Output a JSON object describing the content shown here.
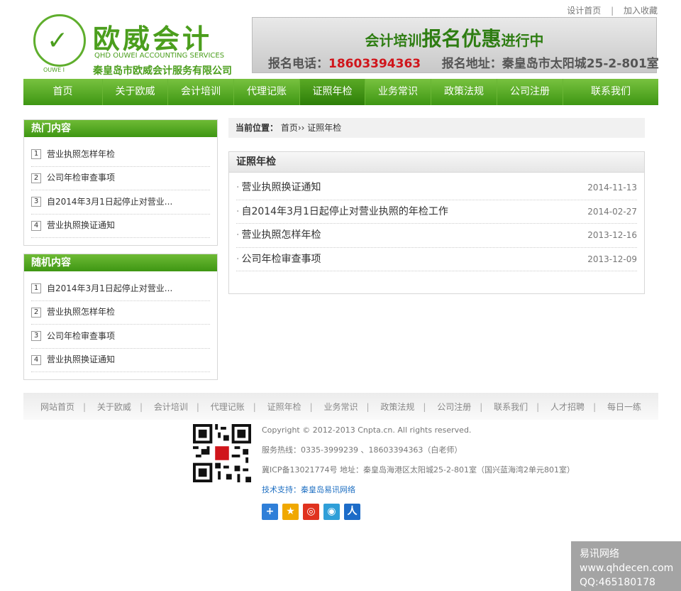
{
  "top_links": {
    "design_home": "设计首页",
    "add_favorite": "加入收藏",
    "separator": "|"
  },
  "logo": {
    "cn_title": "欧威会计",
    "en_sub": "QHD OUWEI ACCOUNTING SERVICES",
    "company": "秦皇岛市欧威会计服务有限公司",
    "mark_text": "OUWE I"
  },
  "banner": {
    "line1_small_a": "会计培训",
    "line1_big": "报名优惠",
    "line1_small_b": "进行中",
    "phone_label": "报名电话：",
    "phone": "18603394363",
    "address_label": "报名地址：",
    "address": "秦皇岛市太阳城25-2-801室"
  },
  "nav": {
    "items": [
      {
        "label": "首页"
      },
      {
        "label": "关于欧威"
      },
      {
        "label": "会计培训"
      },
      {
        "label": "代理记账"
      },
      {
        "label": "证照年检"
      },
      {
        "label": "业务常识"
      },
      {
        "label": "政策法规"
      },
      {
        "label": "公司注册"
      },
      {
        "label": "联系我们"
      }
    ],
    "active_index": 4
  },
  "hot": {
    "title": "热门内容",
    "items": [
      {
        "num": "1",
        "text": "营业执照怎样年检"
      },
      {
        "num": "2",
        "text": "公司年检审查事项"
      },
      {
        "num": "3",
        "text": "自2014年3月1日起停止对营业..."
      },
      {
        "num": "4",
        "text": "营业执照换证通知"
      }
    ]
  },
  "random": {
    "title": "随机内容",
    "items": [
      {
        "num": "1",
        "text": "自2014年3月1日起停止对营业..."
      },
      {
        "num": "2",
        "text": "营业执照怎样年检"
      },
      {
        "num": "3",
        "text": "公司年检审查事项"
      },
      {
        "num": "4",
        "text": "营业执照换证通知"
      }
    ]
  },
  "breadcrumb": {
    "label": "当前位置：",
    "home": "首页",
    "sep": "››",
    "current": "证照年检"
  },
  "panel": {
    "title": "证照年检",
    "articles": [
      {
        "title": "营业执照换证通知",
        "date": "2014-11-13"
      },
      {
        "title": "自2014年3月1日起停止对营业执照的年检工作",
        "date": "2014-02-27"
      },
      {
        "title": "营业执照怎样年检",
        "date": "2013-12-16"
      },
      {
        "title": "公司年检审查事项",
        "date": "2013-12-09"
      }
    ]
  },
  "footer_nav": [
    "网站首页",
    "关于欧威",
    "会计培训",
    "代理记账",
    "证照年检",
    "业务常识",
    "政策法规",
    "公司注册",
    "联系我们",
    "人才招聘",
    "每日一练"
  ],
  "footer": {
    "copyright": "Copyright © 2012-2013 Cnpta.cn. All rights reserved.",
    "hotline": "服务热线：0335-3999239 、18603394363（白老师）",
    "icp": "冀ICP备13021774号  地址：秦皇岛海港区太阳城25-2-801室（国兴蓝海湾2单元801室）",
    "support": "技术支持：秦皇岛易讯网络"
  },
  "share_icons": [
    {
      "name": "plus-share-icon",
      "glyph": "+",
      "color": "#2f7fd8"
    },
    {
      "name": "qzone-icon",
      "glyph": "★",
      "color": "#f0a800"
    },
    {
      "name": "weibo-icon",
      "glyph": "◎",
      "color": "#e0321f"
    },
    {
      "name": "tencent-weibo-icon",
      "glyph": "◉",
      "color": "#2f9fd8"
    },
    {
      "name": "renren-icon",
      "glyph": "人",
      "color": "#1d6cc8"
    }
  ],
  "watermark": {
    "line1": "易讯网络",
    "line2": "www.qhdecen.com",
    "line3": "QQ:465180178"
  }
}
